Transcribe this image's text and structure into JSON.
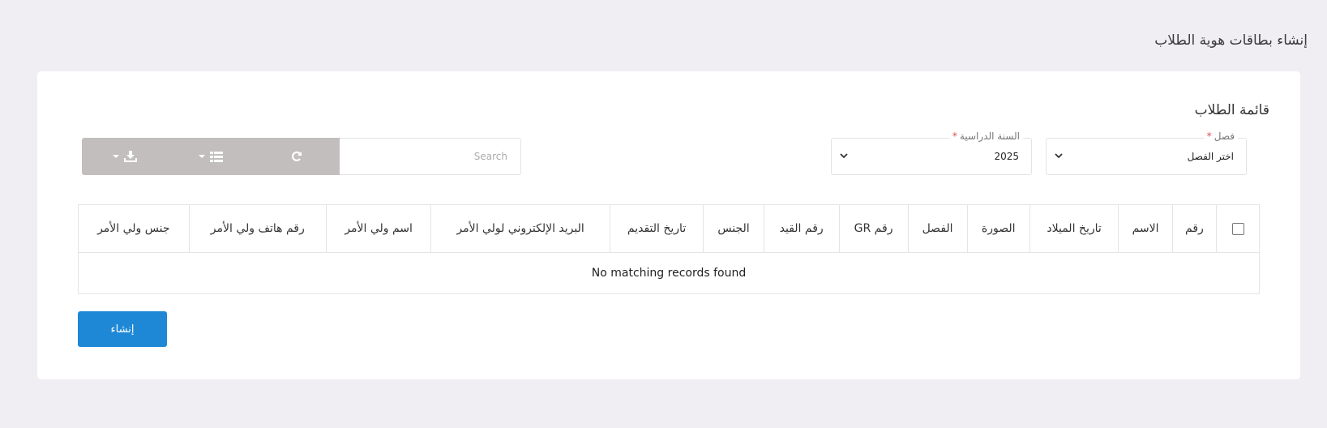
{
  "page": {
    "title": "إنشاء بطاقات هوية الطلاب"
  },
  "card": {
    "title": "قائمة الطلاب"
  },
  "filters": {
    "class": {
      "label": "فصل",
      "required_mark": "*",
      "value": "اختر الفصل"
    },
    "year": {
      "label": "السنة الدراسية",
      "required_mark": "*",
      "value": "2025"
    }
  },
  "search": {
    "placeholder": "Search"
  },
  "toolbar": {
    "icons": [
      "refresh-icon",
      "columns-icon",
      "download-icon"
    ]
  },
  "table": {
    "columns": [
      "رقم",
      "الاسم",
      "تاريخ الميلاد",
      "الصورة",
      "الفصل",
      "رقم GR",
      "رقم القيد",
      "الجنس",
      "تاريخ التقديم",
      "البريد الإلكتروني لولي الأمر",
      "اسم ولي الأمر",
      "رقم هاتف ولي الأمر",
      "جنس ولي الأمر"
    ],
    "empty_message": "No matching records found"
  },
  "actions": {
    "create_label": "إنشاء"
  },
  "colors": {
    "primary": "#1e88d6",
    "toolbar": "#c2bebe",
    "background": "#f1eef3"
  }
}
